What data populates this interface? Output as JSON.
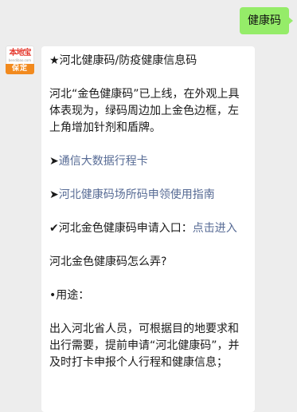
{
  "outgoing_message": {
    "text": "健康码"
  },
  "sender": {
    "logo_text": "本地宝",
    "logo_subtext": "bendibao.com",
    "logo_badge": "保定"
  },
  "incoming_message": {
    "title": "★河北健康码/防疫健康信息码",
    "intro": "河北“金色健康码”已上线，在外观上具体表现为，绿码周边加上金色边框，左上角增加针剂和盾牌。",
    "link1_arrow": "➤",
    "link1_text": "通信大数据行程卡",
    "link2_arrow": "➤",
    "link2_text": "河北健康码场所码申领使用指南",
    "entry_prefix": "✔河北金色健康码申请入口：",
    "entry_link": "点击进入",
    "question": "河北金色健康码怎么弄?",
    "usage_label": "•用途：",
    "usage_text": "出入河北省人员，可根据目的地要求和出行需要，提前申请“河北健康码”，并及时打卡申报个人行程和健康信息；"
  },
  "colors": {
    "background": "#ededed",
    "outgoing_bubble": "#95ec69",
    "incoming_bubble": "#ffffff",
    "link": "#576b95",
    "logo_red": "#e53a2f",
    "badge_orange": "#f28a1e"
  }
}
